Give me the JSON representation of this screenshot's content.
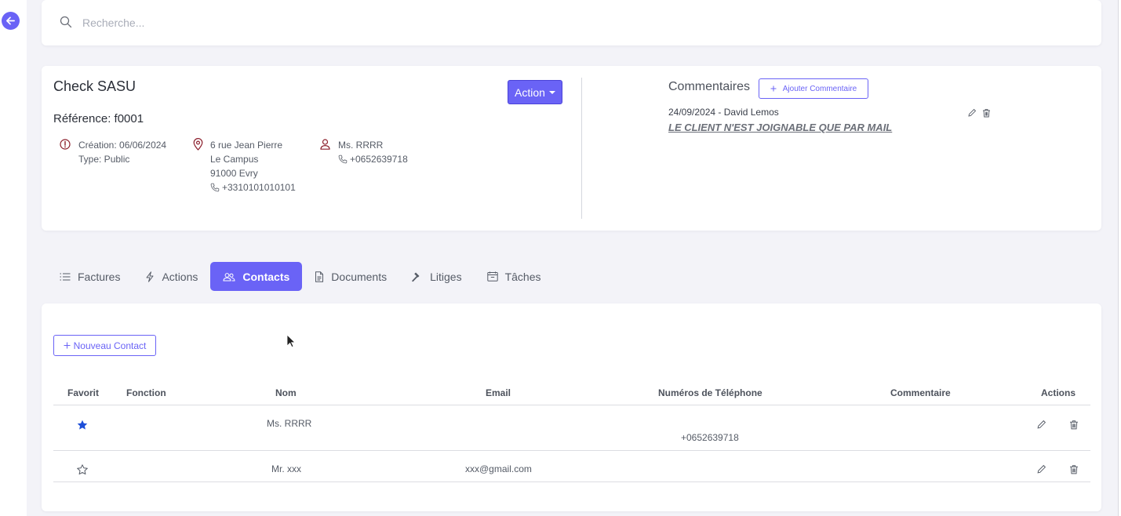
{
  "search": {
    "placeholder": "Recherche..."
  },
  "company": {
    "name": "Check SASU",
    "reference": "Référence: f0001",
    "action_label": "Action",
    "creation": "Création: 06/06/2024",
    "type": "Type: Public",
    "address": {
      "line1": "6 rue Jean Pierre",
      "line2": "Le Campus",
      "line3": "91000 Evry",
      "phone": "+3310101010101"
    },
    "contact": {
      "name": "Ms. RRRR",
      "phone": "+0652639718"
    }
  },
  "comments": {
    "title": "Commentaires",
    "add_label": "Ajouter Commentaire",
    "items": [
      {
        "meta": "24/09/2024 - David Lemos",
        "text": "LE CLIENT N'EST JOIGNABLE QUE PAR MAIL"
      }
    ]
  },
  "tabs": [
    {
      "label": "Factures",
      "icon": "list-icon"
    },
    {
      "label": "Actions",
      "icon": "bolt-icon"
    },
    {
      "label": "Contacts",
      "icon": "users-icon"
    },
    {
      "label": "Documents",
      "icon": "document-icon"
    },
    {
      "label": "Litiges",
      "icon": "hammer-icon"
    },
    {
      "label": "Tâches",
      "icon": "calendar-icon"
    }
  ],
  "active_tab": "Contacts",
  "contacts": {
    "new_label": "Nouveau Contact",
    "headers": {
      "favorite": "Favorit",
      "function": "Fonction",
      "name": "Nom",
      "email": "Email",
      "phones": "Numéros de Téléphone",
      "comment": "Commentaire",
      "actions": "Actions"
    },
    "rows": [
      {
        "favorite": true,
        "function": "",
        "name": "Ms. RRRR",
        "email": "",
        "phone": "+0652639718",
        "comment": ""
      },
      {
        "favorite": false,
        "function": "",
        "name": "Mr. xxx",
        "email": "xxx@gmail.com",
        "phone": "",
        "comment": ""
      }
    ]
  },
  "colors": {
    "accent": "#6a63f6",
    "favorite_star": "#1d4ed8",
    "icon_red": "#8b1e2b"
  }
}
